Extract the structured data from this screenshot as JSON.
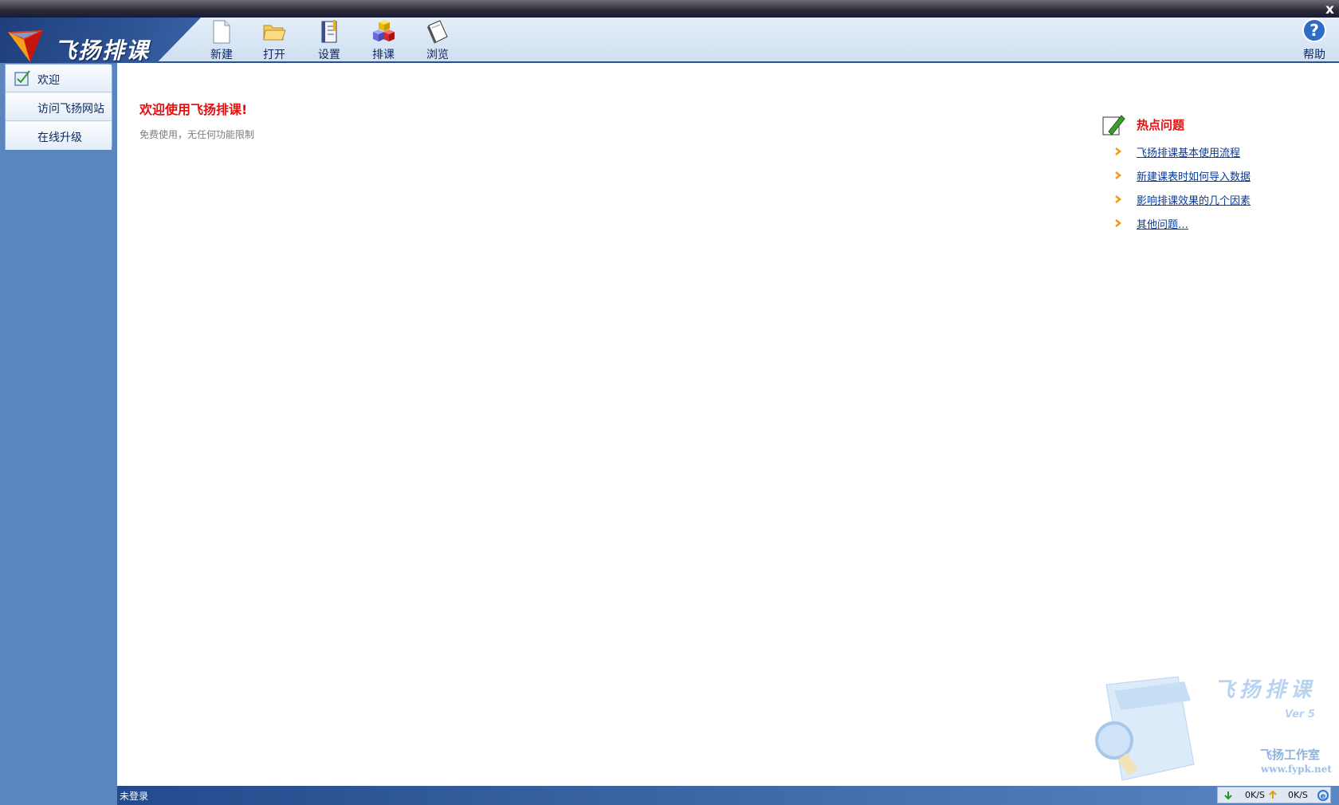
{
  "window": {
    "close_label": "x"
  },
  "app": {
    "title": "飞扬排课"
  },
  "toolbar": {
    "items": [
      {
        "label": "新建",
        "icon": "new-file-icon"
      },
      {
        "label": "打开",
        "icon": "open-folder-icon"
      },
      {
        "label": "设置",
        "icon": "settings-notebook-icon"
      },
      {
        "label": "排课",
        "icon": "schedule-blocks-icon"
      },
      {
        "label": "浏览",
        "icon": "browse-book-icon"
      }
    ],
    "help_label": "帮助"
  },
  "sidebar": {
    "items": [
      {
        "label": "欢迎",
        "icon": "welcome-check-icon"
      },
      {
        "label": "访问飞扬网站"
      },
      {
        "label": "在线升级"
      }
    ]
  },
  "main": {
    "welcome_title": "欢迎使用飞扬排课!",
    "welcome_sub": "免费使用，无任何功能限制",
    "hot": {
      "title": "热点问题",
      "links": [
        "飞扬排课基本使用流程",
        "新建课表时如何导入数据",
        "影响排课效果的几个因素",
        "其他问题…"
      ]
    },
    "watermark": {
      "title": "飞扬排课",
      "version": "Ver 5",
      "studio": "飞扬工作室",
      "url": "www.fypk.net"
    }
  },
  "status": {
    "login": "未登录",
    "download": "0K/S",
    "upload": "0K/S"
  },
  "colors": {
    "accent_red": "#e41010",
    "link_blue": "#0a3a9a",
    "nav_blue": "#2d5394"
  }
}
